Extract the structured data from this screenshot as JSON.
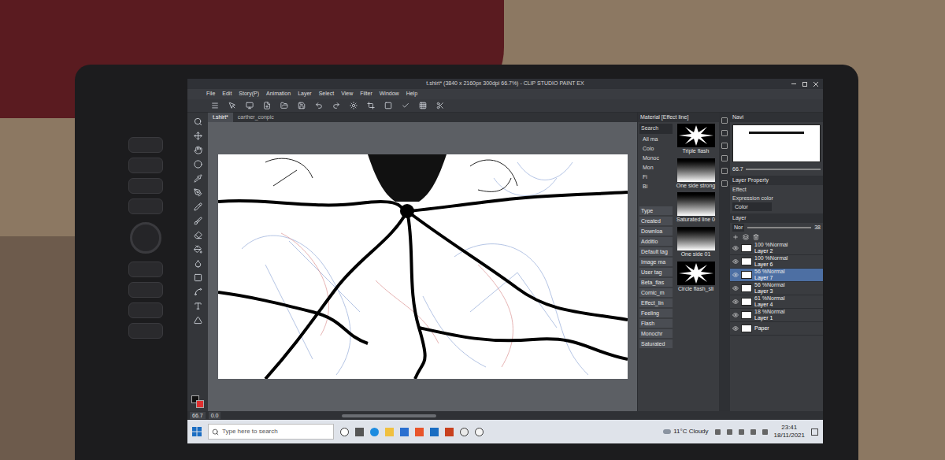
{
  "window": {
    "title": "t.shirt* (3840 x 2160px 300dpi 66.7%) - CLIP STUDIO PAINT EX"
  },
  "menu": [
    "File",
    "Edit",
    "Story(P)",
    "Animation",
    "Layer",
    "Select",
    "View",
    "Filter",
    "Window",
    "Help"
  ],
  "document_tabs": [
    {
      "label": "t.shirt*",
      "selected": true
    },
    {
      "label": "carther_conpic",
      "selected": false
    }
  ],
  "material_panel": {
    "title": "Material [Effect line]",
    "search": "Search",
    "tree": [
      "All ma",
      "Colo",
      "Monoc",
      "Mon",
      "Fi",
      "Bi"
    ],
    "tags": [
      "Type",
      "Created",
      "Downloa",
      "Additio",
      "Default tag",
      "Image ma",
      "User tag",
      "Beta_flas",
      "Comic_m",
      "Effect_lin",
      "Feeling",
      "Flash",
      "Monochr",
      "Saturated"
    ],
    "tiles": [
      {
        "label": "Triple flash",
        "kind": "burst"
      },
      {
        "label": "One side strong",
        "kind": "gradient"
      },
      {
        "label": "Saturated line 0",
        "kind": "gradient"
      },
      {
        "label": "One side 01",
        "kind": "gradient"
      },
      {
        "label": "Circle flash_sli",
        "kind": "burst"
      }
    ]
  },
  "navigator": {
    "title": "Navi",
    "zoom": "66.7"
  },
  "layer_property": {
    "title": "Layer Property",
    "effect": "Effect",
    "expression_color_label": "Expression color",
    "expression_color": "Color"
  },
  "layers": {
    "title": "Layer",
    "blend": "Nor",
    "opacity": "38",
    "items": [
      {
        "mode": "100 %Normal",
        "name": "Layer 2",
        "visible": true,
        "selected": false
      },
      {
        "mode": "100 %Normal",
        "name": "Layer 6",
        "visible": true,
        "selected": false
      },
      {
        "mode": "56 %Normal",
        "name": "Layer 7",
        "visible": true,
        "selected": true
      },
      {
        "mode": "56 %Normal",
        "name": "Layer 3",
        "visible": true,
        "selected": false
      },
      {
        "mode": "61 %Normal",
        "name": "Layer 4",
        "visible": true,
        "selected": false
      },
      {
        "mode": "18 %Normal",
        "name": "Layer 1",
        "visible": true,
        "selected": false
      },
      {
        "mode": "",
        "name": "Paper",
        "visible": true,
        "selected": false
      }
    ]
  },
  "status_bar": {
    "zoom": "66.7",
    "angle": "0.0"
  },
  "taskbar": {
    "search_placeholder": "Type here to search",
    "weather": "11°C Cloudy",
    "time": "23:41",
    "date": "18/11/2021"
  }
}
